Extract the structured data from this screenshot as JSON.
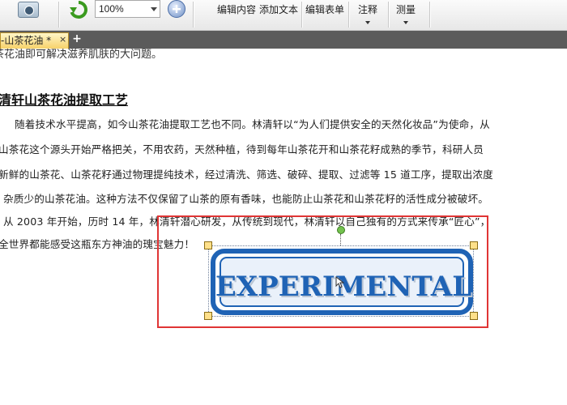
{
  "toolbar": {
    "zoom_value": "100%",
    "edit_content": "编辑内容",
    "add_text": "添加文本",
    "edit_form": "编辑表单",
    "comment": "注释",
    "measure": "测量"
  },
  "tabs": {
    "active_tab": "-山茶花油 *",
    "close_glyph": "×",
    "new_tab_glyph": "+"
  },
  "document": {
    "top_line": "茶花油即可解决滋养肌肤的大问题。",
    "heading": "清轩山茶花油提取工艺",
    "lines": [
      "随着技术水平提高，如今山茶花油提取工艺也不同。林清轩以“为人们提供安全的天然化妆品”为使命，从",
      "山茶花这个源头开始严格把关，不用农药，天然种植，待到每年山茶花开和山茶花籽成熟的季节，科研人员",
      "新鲜的山茶花、山茶花籽通过物理提纯技术，经过清洗、筛选、破碎、提取、过滤等 15 道工序，提取出浓度",
      "杂质少的山茶花油。这种方法不仅保留了山茶的原有香味，也能防止山茶花和山茶花籽的活性成分被破坏。",
      "从 2003 年开始，历时 14 年，林清轩潜心研发，从传统到现代，林清轩以自己独有的方式来传承“匠心”，",
      "全世界都能感受这瓶东方神油的瑰宝魅力！"
    ]
  },
  "stamp": {
    "text": "EXPERIMENTAL",
    "color": "#1f63b5"
  }
}
